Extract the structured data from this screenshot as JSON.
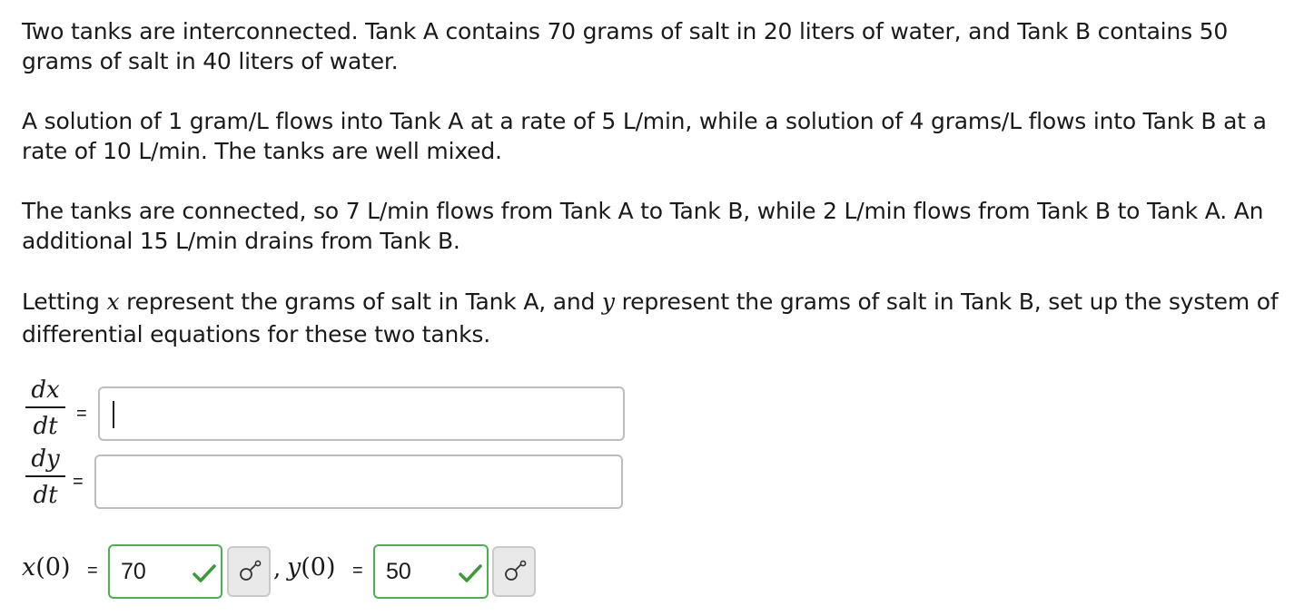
{
  "problem": {
    "para1": "Two tanks are interconnected. Tank A contains 70 grams of salt in 20 liters of water, and Tank B contains 50 grams of salt in 40 liters of water.",
    "para2": "A solution of 1 gram/L flows into Tank A at a rate of 5 L/min, while a solution of 4 grams/L flows into Tank B at a rate of 10 L/min. The tanks are well mixed.",
    "para3": "The tanks are connected, so 7 L/min flows from Tank A to Tank B, while 2 L/min flows from Tank B to Tank A. An additional 15 L/min drains from Tank B.",
    "para4_a": "Letting ",
    "para4_x": "x",
    "para4_b": " represent the grams of salt in Tank A, and ",
    "para4_y": "y",
    "para4_c": " represent the grams of salt in Tank B, set up the system of differential equations for these two tanks."
  },
  "equations": {
    "dx_num": "dx",
    "dx_den": "dt",
    "dy_num": "dy",
    "dy_den": "dt",
    "equals": "=",
    "dx_value": "",
    "dy_value": ""
  },
  "initial_conditions": {
    "x_label": "x",
    "y_label": "y",
    "zero_arg": "(0)",
    "equals": "=",
    "separator": ",",
    "x0_value": "70",
    "y0_value": "50",
    "x0_status": "correct",
    "y0_status": "correct"
  },
  "icons": {
    "check": "check-icon",
    "preview": "preview-key-icon"
  },
  "colors": {
    "correct_border": "#4caf50",
    "check": "#3a9a3a",
    "input_border": "#bdbdbd",
    "button_bg": "#e9e9e9"
  }
}
